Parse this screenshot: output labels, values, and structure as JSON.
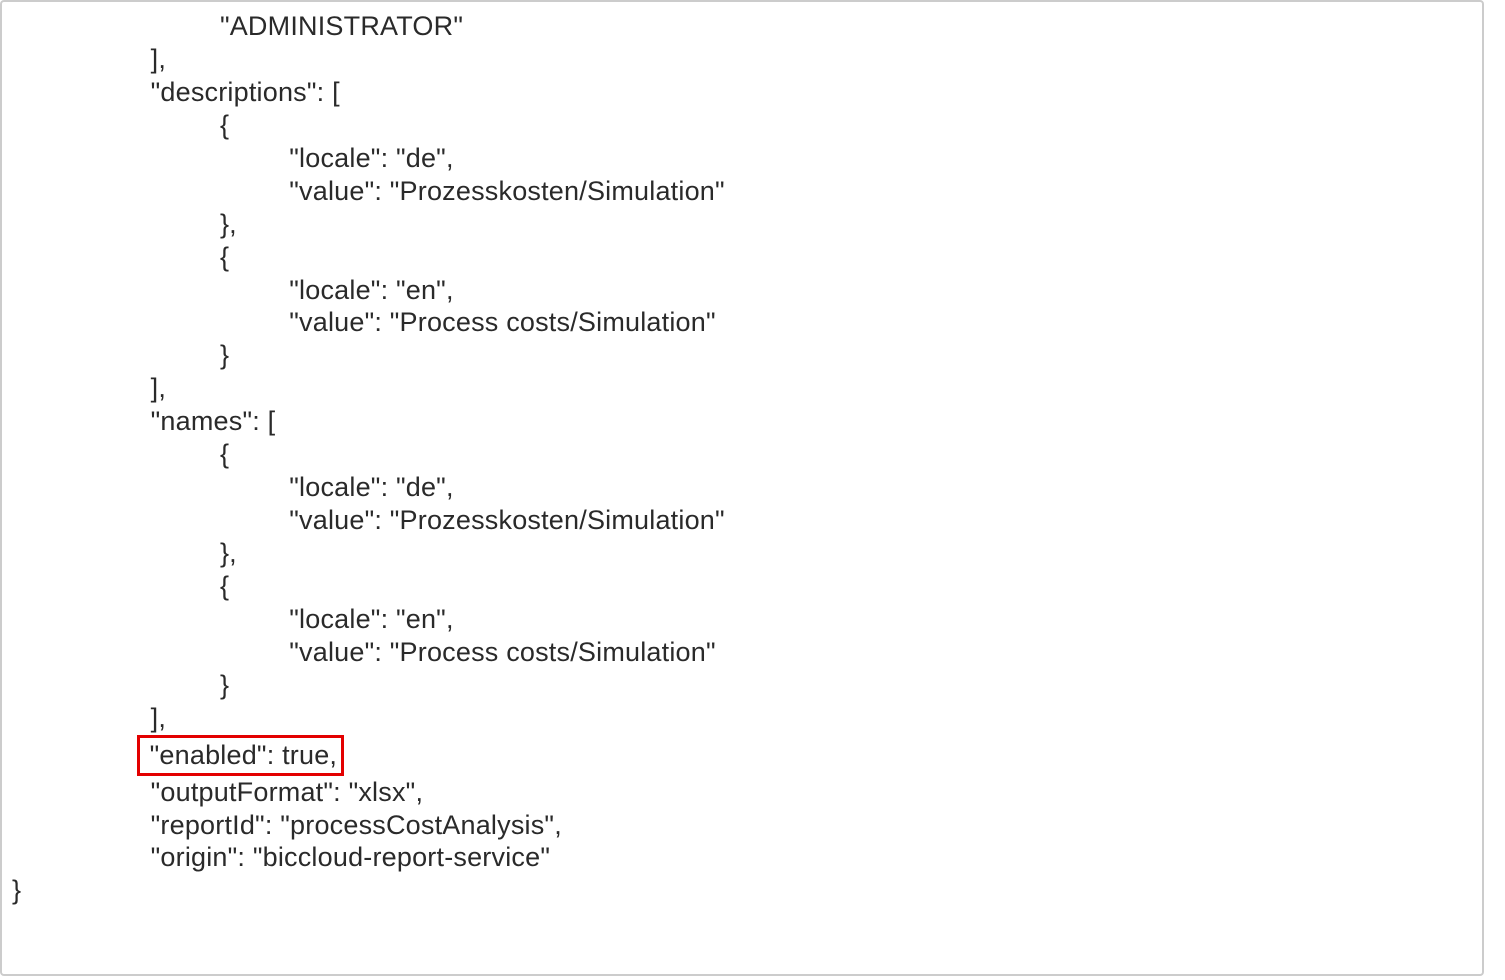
{
  "code": {
    "lines": [
      {
        "indent": 3,
        "text": "\"ADMINISTRATOR\""
      },
      {
        "indent": 2,
        "text": "],"
      },
      {
        "indent": 2,
        "text": "\"descriptions\": ["
      },
      {
        "indent": 3,
        "text": "{"
      },
      {
        "indent": 4,
        "text": "\"locale\": \"de\","
      },
      {
        "indent": 4,
        "text": "\"value\": \"Prozesskosten/Simulation\""
      },
      {
        "indent": 3,
        "text": "},"
      },
      {
        "indent": 3,
        "text": "{"
      },
      {
        "indent": 4,
        "text": "\"locale\": \"en\","
      },
      {
        "indent": 4,
        "text": "\"value\": \"Process costs/Simulation\""
      },
      {
        "indent": 3,
        "text": "}"
      },
      {
        "indent": 2,
        "text": "],"
      },
      {
        "indent": 2,
        "text": "\"names\": ["
      },
      {
        "indent": 3,
        "text": "{"
      },
      {
        "indent": 4,
        "text": "\"locale\": \"de\","
      },
      {
        "indent": 4,
        "text": "\"value\": \"Prozesskosten/Simulation\""
      },
      {
        "indent": 3,
        "text": "},"
      },
      {
        "indent": 3,
        "text": "{"
      },
      {
        "indent": 4,
        "text": "\"locale\": \"en\","
      },
      {
        "indent": 4,
        "text": "\"value\": \"Process costs/Simulation\""
      },
      {
        "indent": 3,
        "text": "}"
      },
      {
        "indent": 2,
        "text": "],"
      },
      {
        "indent": 2,
        "text": "\"enabled\": true,",
        "highlight": true
      },
      {
        "indent": 2,
        "text": "\"outputFormat\": \"xlsx\","
      },
      {
        "indent": 2,
        "text": "\"reportId\": \"processCostAnalysis\","
      },
      {
        "indent": 2,
        "text": "\"origin\": \"biccloud-report-service\""
      },
      {
        "indent": 0,
        "text": "}"
      }
    ]
  },
  "indent_unit": "         "
}
